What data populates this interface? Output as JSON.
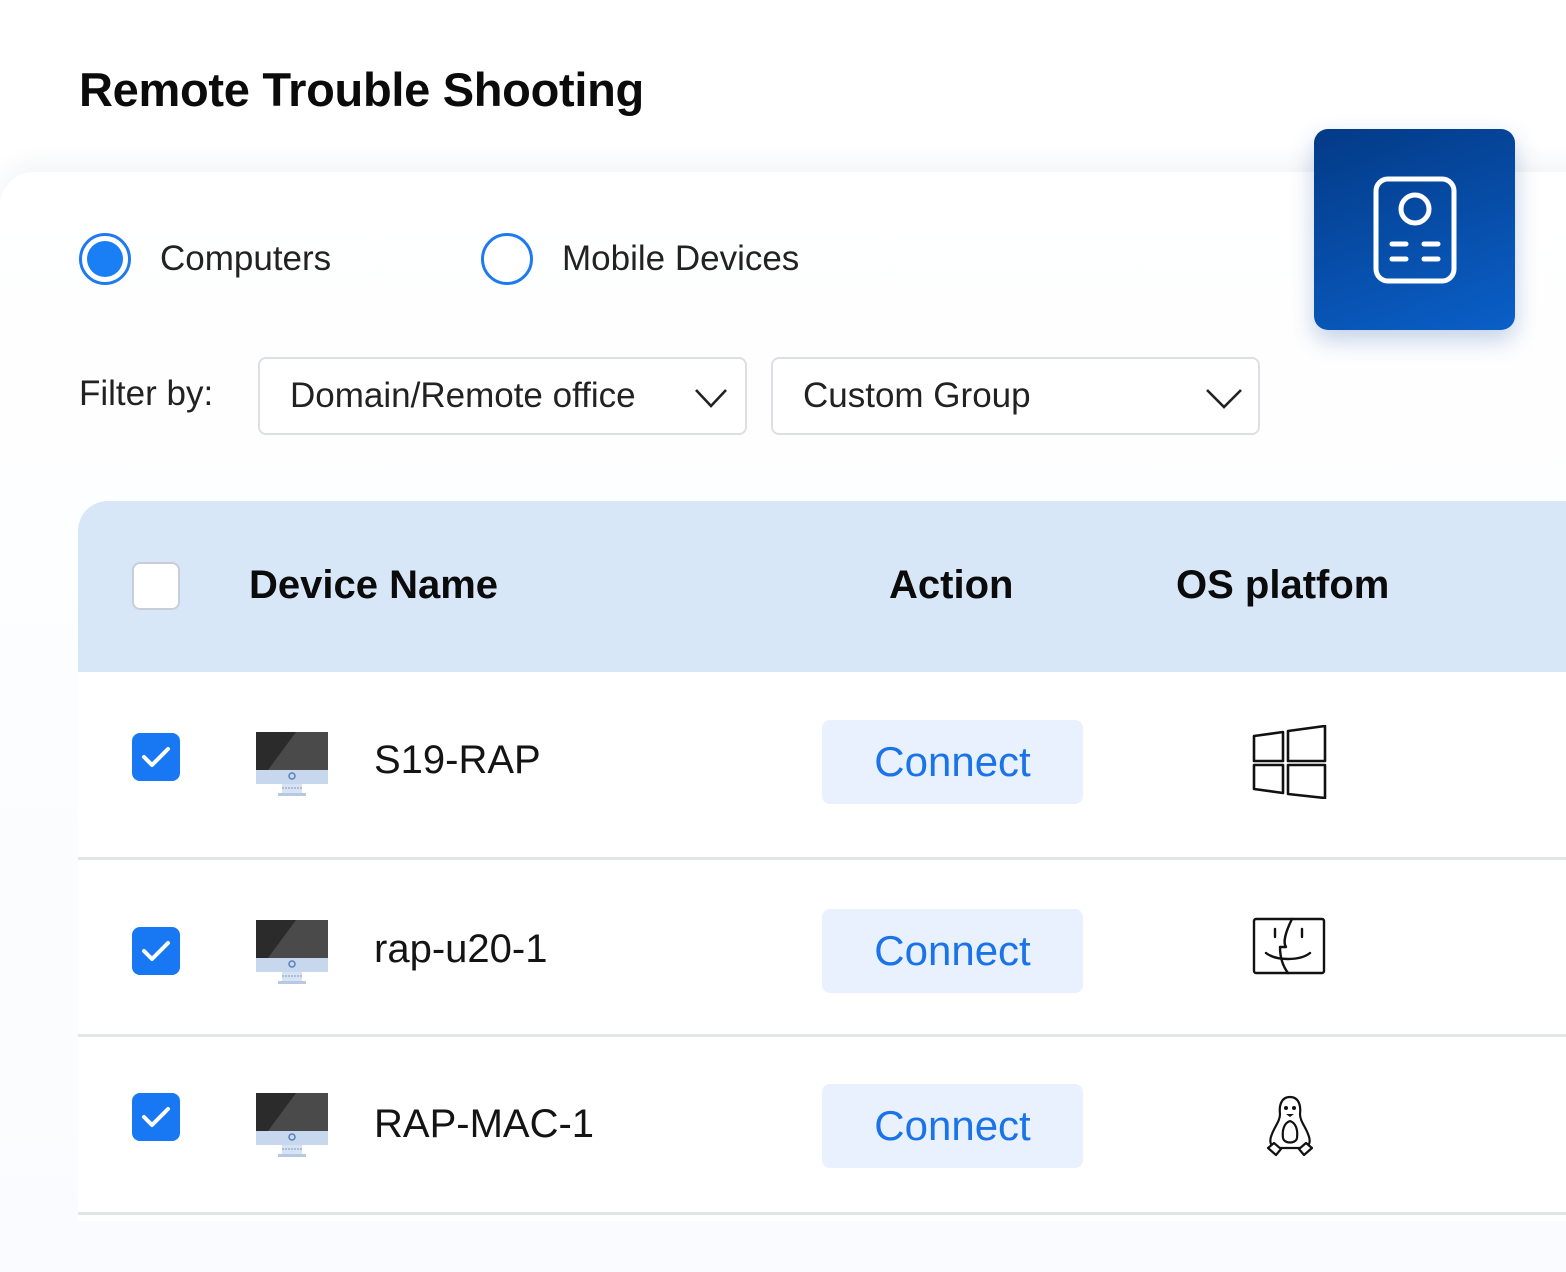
{
  "page": {
    "title": "Remote Trouble Shooting"
  },
  "badge": {
    "icon": "remote-device-icon",
    "color": "#0a4fb0"
  },
  "device_type": {
    "options": [
      {
        "label": "Computers",
        "selected": true
      },
      {
        "label": "Mobile Devices",
        "selected": false
      }
    ]
  },
  "filter": {
    "label": "Filter by:",
    "domain": "Domain/Remote office",
    "group": "Custom Group"
  },
  "table": {
    "columns": [
      "Device Name",
      "Action",
      "OS platfom"
    ],
    "select_all_checked": false,
    "rows": [
      {
        "checked": true,
        "device_icon": "monitor-icon",
        "name": "S19-RAP",
        "action": "Connect",
        "os": "windows-icon"
      },
      {
        "checked": true,
        "device_icon": "monitor-icon",
        "name": "rap-u20-1",
        "action": "Connect",
        "os": "mac-finder-icon"
      },
      {
        "checked": true,
        "device_icon": "monitor-icon",
        "name": "RAP-MAC-1",
        "action": "Connect",
        "os": "linux-tux-icon"
      }
    ]
  },
  "colors": {
    "accent": "#1877f2",
    "header_bg": "#d8e7f8",
    "connect_bg": "#e8f1fd",
    "connect_text": "#1a73e8"
  }
}
